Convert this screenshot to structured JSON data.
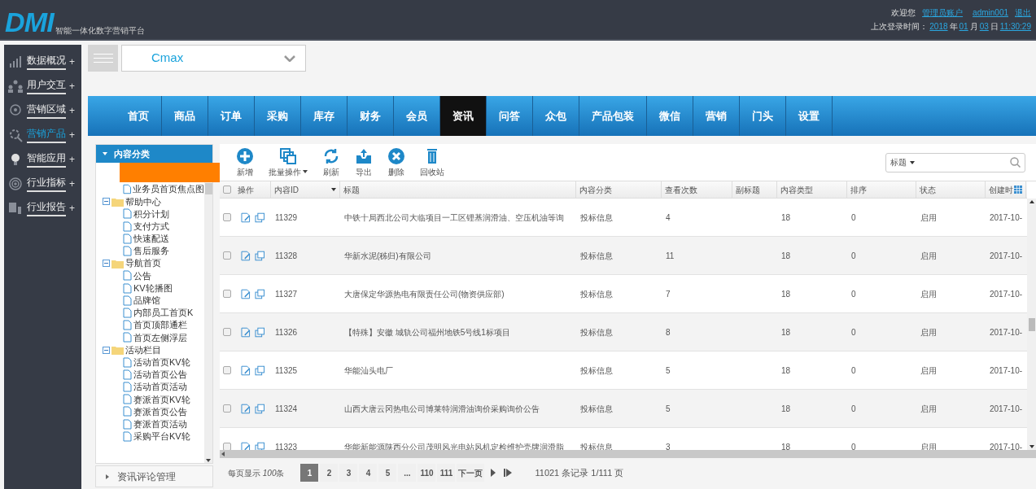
{
  "header": {
    "logo": "DMI",
    "subtitle": "智能一体化数字营销平台",
    "welcome": "欢迎您",
    "account": "管理员账户",
    "user": "admin001",
    "logout": "退出",
    "last_login_label": "上次登录时间：",
    "year": "2018",
    "year_unit": "年",
    "month": "01",
    "month_unit": "月",
    "day": "03",
    "day_unit": "日",
    "time": "11:30:29"
  },
  "sidebar": {
    "items": [
      {
        "label": "数据概况",
        "selected": false
      },
      {
        "label": "用户交互",
        "selected": false
      },
      {
        "label": "营销区域",
        "selected": false
      },
      {
        "label": "营销产品",
        "selected": true
      },
      {
        "label": "智能应用",
        "selected": false
      },
      {
        "label": "行业指标",
        "selected": false
      },
      {
        "label": "行业报告",
        "selected": false
      }
    ],
    "expand_mark": "+"
  },
  "site_select": {
    "value": "Cmax"
  },
  "nav_tabs": [
    {
      "label": "首页",
      "selected": false
    },
    {
      "label": "商品",
      "selected": false
    },
    {
      "label": "订单",
      "selected": false
    },
    {
      "label": "采购",
      "selected": false
    },
    {
      "label": "库存",
      "selected": false
    },
    {
      "label": "财务",
      "selected": false
    },
    {
      "label": "会员",
      "selected": false
    },
    {
      "label": "资讯",
      "selected": true
    },
    {
      "label": "问答",
      "selected": false
    },
    {
      "label": "众包",
      "selected": false
    },
    {
      "label": "产品包装",
      "selected": false
    },
    {
      "label": "微信",
      "selected": false
    },
    {
      "label": "营销",
      "selected": false
    },
    {
      "label": "门头",
      "selected": false
    },
    {
      "label": "设置",
      "selected": false
    }
  ],
  "tree_panel": {
    "title": "内容分类",
    "items": [
      {
        "label": "业务员首页焦点图",
        "kind": "file"
      },
      {
        "label": "帮助中心",
        "kind": "folder",
        "expanded": true,
        "children": [
          {
            "label": "积分计划",
            "kind": "file"
          },
          {
            "label": "支付方式",
            "kind": "file"
          },
          {
            "label": "快速配送",
            "kind": "file"
          },
          {
            "label": "售后服务",
            "kind": "file"
          }
        ]
      },
      {
        "label": "导航首页",
        "kind": "folder",
        "expanded": true,
        "children": [
          {
            "label": "公告",
            "kind": "file"
          },
          {
            "label": "KV轮播图",
            "kind": "file"
          },
          {
            "label": "品牌馆",
            "kind": "file"
          },
          {
            "label": "内部员工首页K",
            "kind": "file"
          },
          {
            "label": "首页顶部通栏",
            "kind": "file"
          },
          {
            "label": "首页左侧浮层",
            "kind": "file"
          }
        ]
      },
      {
        "label": "活动栏目",
        "kind": "folder",
        "expanded": true,
        "children": [
          {
            "label": "活动首页KV轮",
            "kind": "file"
          },
          {
            "label": "活动首页公告",
            "kind": "file"
          },
          {
            "label": "活动首页活动",
            "kind": "file"
          },
          {
            "label": "赛派首页KV轮",
            "kind": "file"
          },
          {
            "label": "赛派首页公告",
            "kind": "file"
          },
          {
            "label": "赛派首页活动",
            "kind": "file"
          },
          {
            "label": "采购平台KV轮",
            "kind": "file"
          }
        ]
      }
    ],
    "footer_section": "资讯评论管理"
  },
  "toolbar": [
    {
      "label": "新增",
      "dropdown": false
    },
    {
      "label": "批量操作",
      "dropdown": true
    },
    {
      "label": "刷新",
      "dropdown": false
    },
    {
      "label": "导出",
      "dropdown": false
    },
    {
      "label": "删除",
      "dropdown": false
    },
    {
      "label": "回收站",
      "dropdown": false
    }
  ],
  "search": {
    "field": "标题"
  },
  "table": {
    "all_checked": false,
    "columns": [
      "操作",
      "内容ID",
      "标题",
      "内容分类",
      "查看次数",
      "副标题",
      "内容类型",
      "排序",
      "状态",
      "创建时"
    ],
    "rows": [
      {
        "checked": false,
        "id": "11329",
        "title": "中铁十局西北公司大临项目一工区锂基润滑油、空压机油等询",
        "category": "投标信息",
        "views": "4",
        "type": "18",
        "order": "0",
        "status": "启用",
        "created": "2017-10-"
      },
      {
        "checked": false,
        "id": "11328",
        "title": "华新水泥(秭归)有限公司",
        "category": "投标信息",
        "views": "11",
        "type": "18",
        "order": "0",
        "status": "启用",
        "created": "2017-10-"
      },
      {
        "checked": false,
        "id": "11327",
        "title": "大唐保定华源热电有限责任公司(物资供应部)",
        "category": "投标信息",
        "views": "7",
        "type": "18",
        "order": "0",
        "status": "启用",
        "created": "2017-10-"
      },
      {
        "checked": false,
        "id": "11326",
        "title": "【特殊】安徽 城轨公司福州地铁5号线1标项目",
        "category": "投标信息",
        "views": "8",
        "type": "18",
        "order": "0",
        "status": "启用",
        "created": "2017-10-"
      },
      {
        "checked": false,
        "id": "11325",
        "title": "华能汕头电厂",
        "category": "投标信息",
        "views": "5",
        "type": "18",
        "order": "0",
        "status": "启用",
        "created": "2017-10-"
      },
      {
        "checked": false,
        "id": "11324",
        "title": "山西大唐云冈热电公司博莱特润滑油询价采购询价公告",
        "category": "投标信息",
        "views": "5",
        "type": "18",
        "order": "0",
        "status": "启用",
        "created": "2017-10-"
      },
      {
        "checked": false,
        "id": "11323",
        "title": "华能新能源陕西分公司茂明风光电站风机定检维护壳牌润滑脂",
        "category": "投标信息",
        "views": "3",
        "type": "18",
        "order": "0",
        "status": "启用",
        "created": "2017-10-"
      }
    ]
  },
  "pagination": {
    "page_size_label": "每页显示",
    "page_size": "100",
    "page_size_unit": "条",
    "pages": [
      {
        "label": "1",
        "selected": true
      },
      {
        "label": "2",
        "selected": false
      },
      {
        "label": "3",
        "selected": false
      },
      {
        "label": "4",
        "selected": false
      },
      {
        "label": "5",
        "selected": false
      },
      {
        "label": "...",
        "selected": false
      },
      {
        "label": "110",
        "selected": false
      },
      {
        "label": "111",
        "selected": false
      }
    ],
    "next": "下一页",
    "summary": "11021 条记录 1/111 页"
  }
}
